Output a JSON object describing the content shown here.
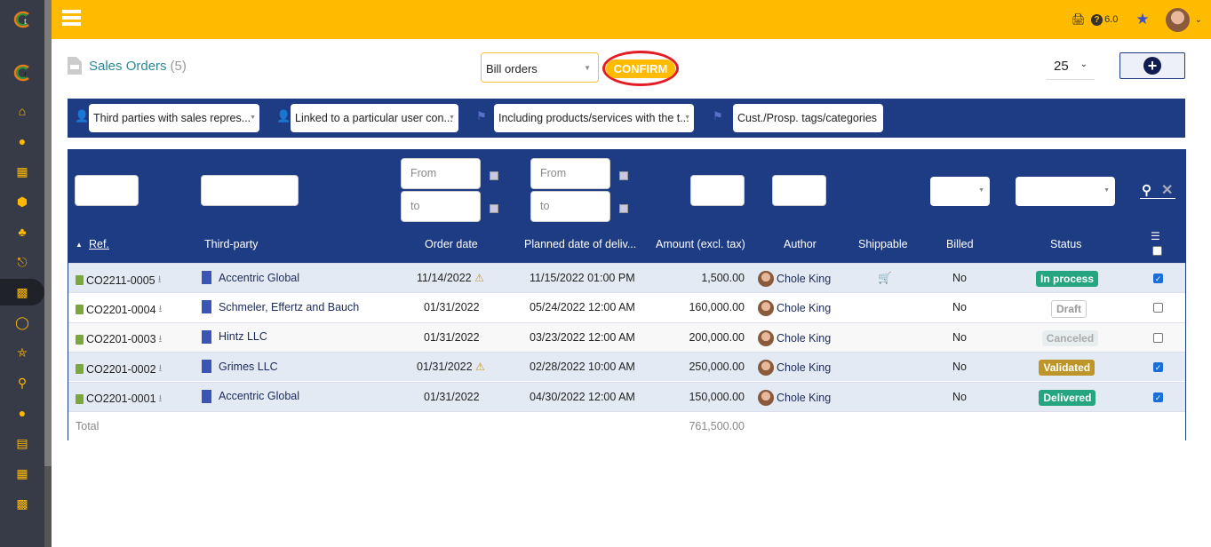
{
  "topbar": {
    "version": "6.0",
    "icons": [
      "printer-icon",
      "help-icon",
      "star-icon"
    ]
  },
  "sidebar": {
    "items": [
      "home-icon",
      "user-icon",
      "building-icon",
      "product-icon",
      "cubes-icon",
      "project-icon",
      "briefcase-icon",
      "coins-icon",
      "bank-icon",
      "search-dollar-icon",
      "employee-icon",
      "folder-icon",
      "calendar-icon",
      "ticket-icon"
    ],
    "active": 6
  },
  "page": {
    "title": "Sales Orders",
    "count": "(5)"
  },
  "massaction": {
    "selected": "Bill orders",
    "confirm": "CONFIRM"
  },
  "limit": "25",
  "filters": [
    "Third parties with sales repres...",
    "Linked to a particular user con...",
    "Including products/services with the t...",
    "Cust./Prosp. tags/categories"
  ],
  "search": {
    "from": "From",
    "to": "to"
  },
  "columns": [
    "Ref.",
    "Third-party",
    "Order date",
    "Planned date of deliv...",
    "Amount (excl. tax)",
    "Author",
    "Shippable",
    "Billed",
    "Status"
  ],
  "rows": [
    {
      "ref": "CO2211-0005",
      "third": "Accentric Global",
      "date": "11/14/2022",
      "warn": true,
      "planned": "11/15/2022 01:00 PM",
      "amount": "1,500.00",
      "author": "Chole King",
      "ship": true,
      "billed": "No",
      "status": "In process",
      "status_color": "#25a580",
      "checked": true
    },
    {
      "ref": "CO2201-0004",
      "third": "Schmeler, Effertz and Bauch",
      "date": "01/31/2022",
      "warn": false,
      "planned": "05/24/2022 12:00 AM",
      "amount": "160,000.00",
      "author": "Chole King",
      "ship": false,
      "billed": "No",
      "status": "Draft",
      "status_color": "#999999",
      "checked": false
    },
    {
      "ref": "CO2201-0003",
      "third": "Hintz LLC",
      "date": "01/31/2022",
      "warn": false,
      "planned": "03/23/2022 12:00 AM",
      "amount": "200,000.00",
      "author": "Chole King",
      "ship": false,
      "billed": "No",
      "status": "Canceled",
      "status_color": "#aaaaaa",
      "checked": false
    },
    {
      "ref": "CO2201-0002",
      "third": "Grimes LLC",
      "date": "01/31/2022",
      "warn": true,
      "planned": "02/28/2022 10:00 AM",
      "amount": "250,000.00",
      "author": "Chole King",
      "ship": false,
      "billed": "No",
      "status": "Validated",
      "status_color": "#bd9528",
      "checked": true
    },
    {
      "ref": "CO2201-0001",
      "third": "Accentric Global",
      "date": "01/31/2022",
      "warn": false,
      "planned": "04/30/2022 12:00 AM",
      "amount": "150,000.00",
      "author": "Chole King",
      "ship": false,
      "billed": "No",
      "status": "Delivered",
      "status_color": "#25a580",
      "checked": true
    }
  ],
  "total": {
    "label": "Total",
    "amount": "761,500.00"
  }
}
